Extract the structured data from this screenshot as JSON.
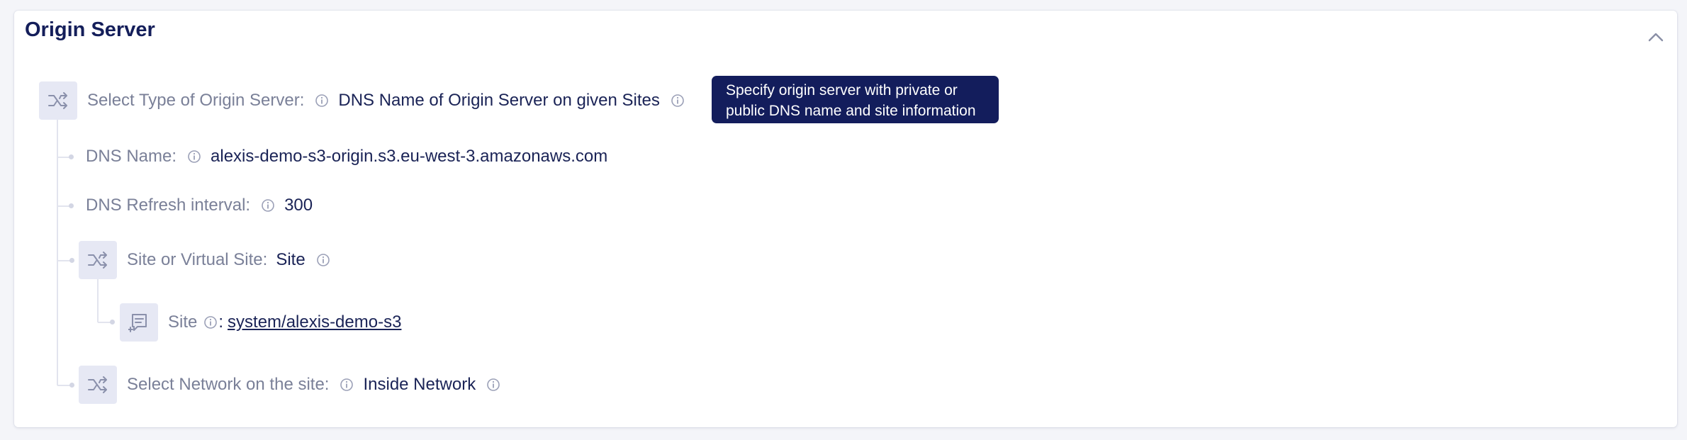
{
  "section": {
    "title": "Origin Server",
    "collapse_icon": "chevron-up-icon"
  },
  "origin_type": {
    "label": "Select Type of Origin Server:",
    "value": "DNS Name of Origin Server on given Sites",
    "icon": "switch-icon"
  },
  "tooltip": {
    "line1": "Specify origin server with private or",
    "line2": "public DNS name and site information"
  },
  "dns_name": {
    "label": "DNS Name:",
    "value": "alexis-demo-s3-origin.s3.eu-west-3.amazonaws.com"
  },
  "dns_refresh": {
    "label": "DNS Refresh interval:",
    "value": "300"
  },
  "site_type": {
    "label": "Site or Virtual Site:",
    "value": "Site",
    "icon": "switch-icon"
  },
  "site": {
    "label": "Site",
    "value": "system/alexis-demo-s3",
    "icon": "site-object-icon"
  },
  "network": {
    "label": "Select Network on the site:",
    "value": "Inside Network",
    "icon": "switch-icon"
  },
  "colors": {
    "text_dark": "#1a2356",
    "label_gray": "#7a8098",
    "tile_bg": "#e6e8f4",
    "tooltip_bg": "#131d5c"
  }
}
